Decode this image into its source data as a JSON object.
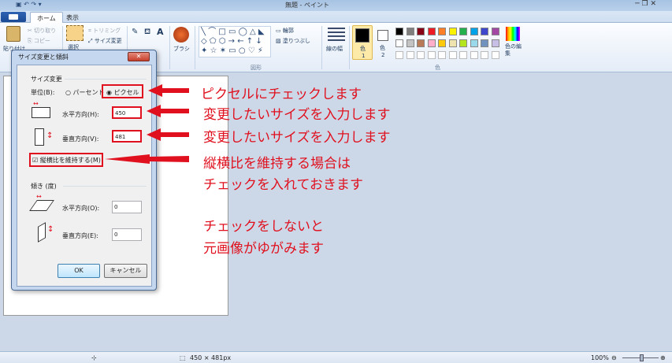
{
  "window": {
    "title": "無題 - ペイント"
  },
  "tabs": [
    {
      "label": "ホーム"
    },
    {
      "label": "表示"
    }
  ],
  "ribbon": {
    "clipboard": {
      "paste": "貼り付け",
      "cut": "切り取り",
      "copy": "コピー"
    },
    "image": {
      "select": "選択",
      "crop": "トリミング",
      "resize": "サイズ変更"
    },
    "brush": "ブラシ",
    "shapes": {
      "outline": "輪郭",
      "fill": "塗りつぶし",
      "group_label": "図形"
    },
    "size_label": "線の幅",
    "color1": {
      "label": "色",
      "index": "1"
    },
    "color2": {
      "label": "色",
      "index": "2"
    },
    "edit_colors": "色の編集",
    "colors_group_label": "色",
    "palette_row1": [
      "#000000",
      "#7f7f7f",
      "#880015",
      "#ed1c24",
      "#ff7f27",
      "#fff200",
      "#22b14c",
      "#00a2e8",
      "#3f48cc",
      "#a349a4"
    ],
    "palette_row2": [
      "#ffffff",
      "#c3c3c3",
      "#b97a57",
      "#ffaec9",
      "#ffc90e",
      "#efe4b0",
      "#b5e61d",
      "#99d9ea",
      "#7092be",
      "#c8bfe7"
    ]
  },
  "dialog": {
    "title": "サイズ変更と傾斜",
    "close": "✕",
    "resize_section": "サイズ変更",
    "unit_label": "単位(B):",
    "percent_label": "パーセント",
    "pixel_label": "ピクセル",
    "horizontal_label": "水平方向(H):",
    "horizontal_value": "450",
    "vertical_label": "垂直方向(V):",
    "vertical_value": "481",
    "maintain_aspect_label": "縦横比を維持する(M)",
    "skew_section": "傾き (度)",
    "skew_h_label": "水平方向(O):",
    "skew_h_value": "0",
    "skew_v_label": "垂直方向(E):",
    "skew_v_value": "0",
    "ok": "OK",
    "cancel": "キャンセル"
  },
  "annotations": {
    "a1": "ピクセルにチェックします",
    "a2": "変更したいサイズを入力します",
    "a3": "変更したいサイズを入力します",
    "a4_line1": "縦横比を維持する場合は",
    "a4_line2": "チェックを入れておきます",
    "a5_line1": "チェックをしないと",
    "a5_line2": "元画像がゆがみます"
  },
  "status": {
    "dimensions": "450 × 481px",
    "zoom": "100%"
  },
  "colors": {
    "annotation_red": "#e0101e",
    "accent_blue": "#1b4a94"
  }
}
